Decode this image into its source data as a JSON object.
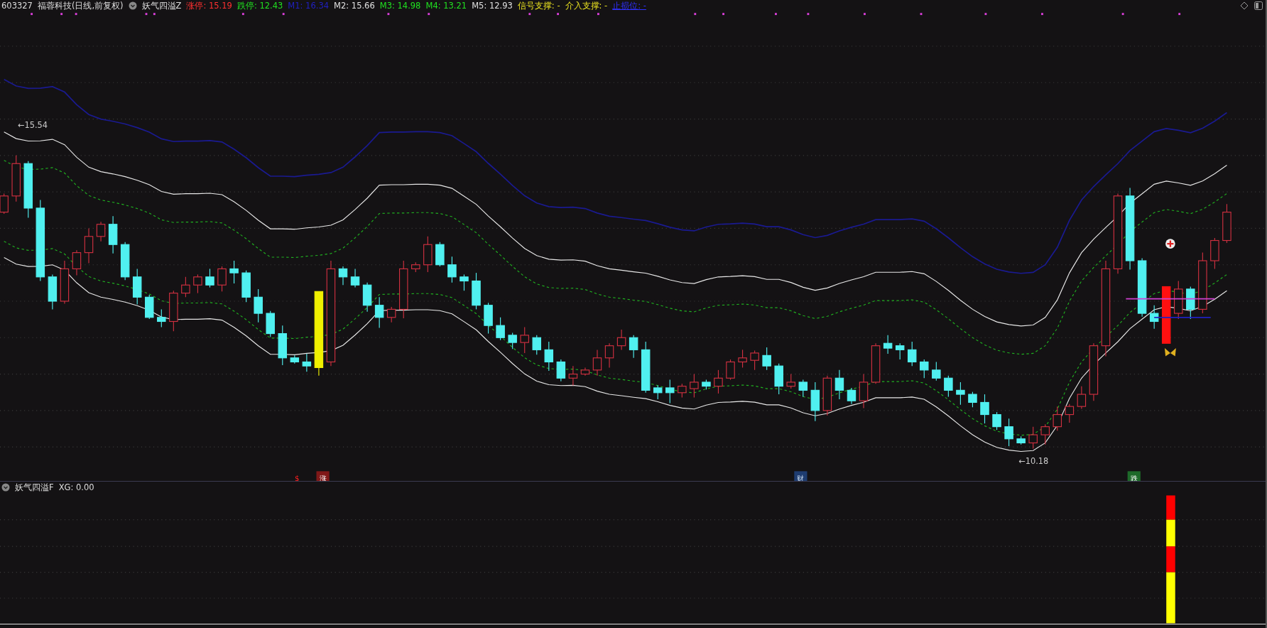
{
  "header": {
    "code": "603327",
    "title": "福蓉科技(日线,前复权)",
    "indicator": "妖气四溢Z",
    "values": [
      {
        "text": "涨停: 15.19",
        "color": "#ff3030"
      },
      {
        "text": "跌停: 12.43",
        "color": "#20e020"
      },
      {
        "text": "M1: 16.34",
        "color": "#2020c0"
      },
      {
        "text": "M2: 15.66",
        "color": "#e0e0e0"
      },
      {
        "text": "M3: 14.98",
        "color": "#20e020"
      },
      {
        "text": "M4: 13.21",
        "color": "#20e020"
      },
      {
        "text": "M5: 12.93",
        "color": "#e0e0e0"
      },
      {
        "text": "信号支撑: -",
        "color": "#e8e020"
      },
      {
        "text": "介入支撑: -",
        "color": "#e8e020"
      },
      {
        "text": "止损位: -",
        "color": "#3030ff",
        "underline": true
      }
    ]
  },
  "price_labels": [
    "←15.54",
    "←10.18"
  ],
  "markers": [
    {
      "text": "$",
      "kind": "dollar"
    },
    {
      "text": "涨",
      "kind": "rise"
    },
    {
      "text": "财",
      "kind": "finance"
    },
    {
      "text": "跌",
      "kind": "fall"
    }
  ],
  "lower_panel": {
    "indicator": "妖气四溢F",
    "reading": "XG: 0.00"
  }
}
